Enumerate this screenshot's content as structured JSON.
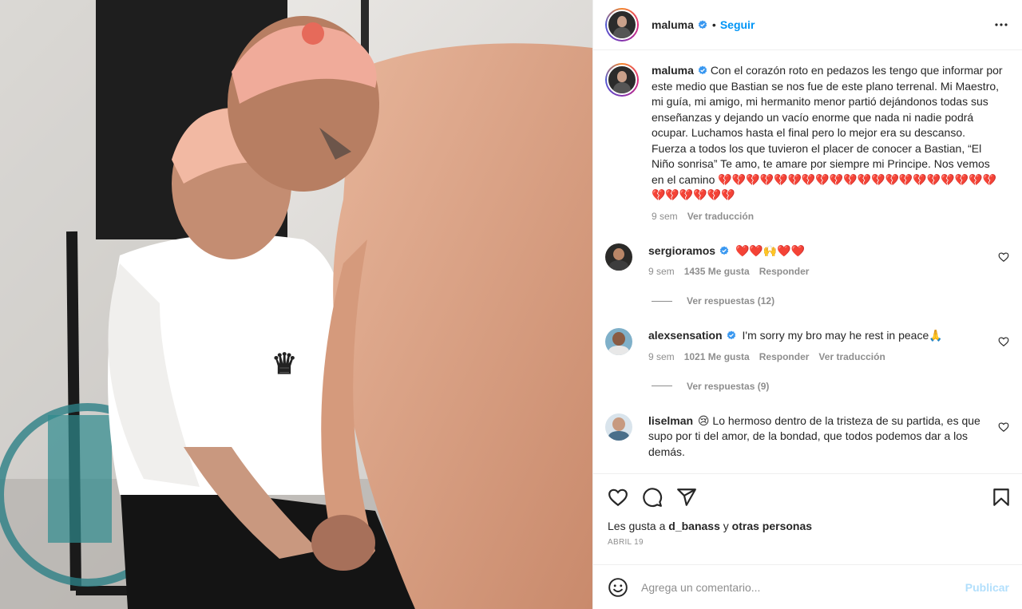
{
  "header": {
    "username": "maluma",
    "follow_label": "Seguir",
    "separator": "•"
  },
  "caption": {
    "username": "maluma",
    "text": "Con el corazón roto en pedazos les tengo que informar por este medio que Bastian se nos fue de este plano terrenal. Mi Maestro, mi guía, mi amigo, mi hermanito menor partió dejándonos todas sus enseñanzas y dejando un vacío enorme que nada ni nadie podrá ocupar. Luchamos hasta el final pero lo mejor era su descanso. Fuerza a todos los que tuvieron el placer de conocer a Bastian, “El Niño sonrisa” Te amo, te amare por siempre mi Principe. Nos vemos en el camino ",
    "hearts": "💔💔💔💔💔💔💔💔💔💔💔💔💔💔💔💔💔💔💔💔💔💔💔💔💔💔",
    "time": "9 sem",
    "translate_label": "Ver traducción"
  },
  "comments": [
    {
      "username": "sergioramos",
      "verified": true,
      "text": "❤️❤️🙌❤️❤️",
      "time": "9 sem",
      "likes": "1435 Me gusta",
      "reply_label": "Responder",
      "translate_label": "",
      "view_replies": "Ver respuestas (12)"
    },
    {
      "username": "alexsensation",
      "verified": true,
      "text": "I'm sorry my bro may he rest in peace🙏",
      "time": "9 sem",
      "likes": "1021 Me gusta",
      "reply_label": "Responder",
      "translate_label": "Ver traducción",
      "view_replies": "Ver respuestas (9)"
    },
    {
      "username": "liselman",
      "verified": false,
      "text": "😢 Lo hermoso dentro de la tristeza de su partida, es que supo por ti del amor, de la bondad, que todos podemos dar a los demás."
    }
  ],
  "likes": {
    "prefix": "Les gusta a ",
    "user": "d_banass",
    "middle": " y ",
    "others": "otras personas"
  },
  "date": "ABRIL 19",
  "add_comment": {
    "placeholder": "Agrega un comentario...",
    "post_label": "Publicar"
  },
  "colors": {
    "accent": "#0095f6",
    "verified": "#3897f0",
    "muted": "#8e8e8e",
    "post_disabled": "#b2dffc"
  },
  "icons": {
    "more": "more-options-icon",
    "like": "heart-icon",
    "comment": "comment-icon",
    "share": "share-icon",
    "save": "bookmark-icon",
    "emoji": "emoji-icon"
  }
}
